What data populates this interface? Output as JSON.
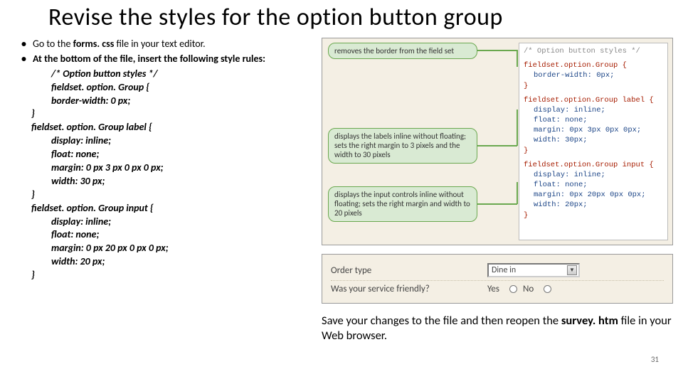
{
  "title": "Revise the styles for the option button group",
  "bullets": {
    "b1_pre": "Go to the ",
    "b1_bold": "forms. css",
    "b1_post": " file in your text editor.",
    "b2": "At the bottom of the file, insert the following style rules:"
  },
  "code": {
    "l1": "/* Option button styles */",
    "l2": "fieldset. option. Group {",
    "l3": "border-width: 0 px;",
    "l4": "}",
    "l5": "fieldset. option. Group label {",
    "l6": "display: inline;",
    "l7": "float: none;",
    "l8": "margin: 0 px 3 px 0 px 0 px;",
    "l9": "width: 30 px;",
    "l10": "}",
    "l11": "fieldset. option. Group input {",
    "l12": "display: inline;",
    "l13": "float: none;",
    "l14": "margin: 0 px 20 px 0 px 0 px;",
    "l15": "width: 20 px;",
    "l16": "}"
  },
  "callouts": {
    "c1": "removes the border from the field set",
    "c2": "displays the labels inline without floating; sets the right margin to 3 pixels and the width to 30 pixels",
    "c3": "displays the input controls inline without floating; sets the right margin and width to 20 pixels"
  },
  "codepane": {
    "cmt": "/* Option button styles */",
    "s1": "fieldset.option.Group {",
    "p1": "border-width: 0px;",
    "cb": "}",
    "s2": "fieldset.option.Group label {",
    "p2a": "display: inline;",
    "p2b": "float: none;",
    "p2c": "margin: 0px 3px 0px 0px;",
    "p2d": "width: 30px;",
    "s3": "fieldset.option.Group input {",
    "p3a": "display: inline;",
    "p3b": "float: none;",
    "p3c": "margin: 0px 20px 0px 0px;",
    "p3d": "width: 20px;"
  },
  "form": {
    "label1": "Order type",
    "select_value": "Dine in",
    "label2": "Was your service friendly?",
    "yes": "Yes",
    "no": "No"
  },
  "bottom": {
    "pre": "Save your changes to the file and then reopen the ",
    "bold": "survey. htm",
    "post": " file in your Web browser."
  },
  "page": "31"
}
